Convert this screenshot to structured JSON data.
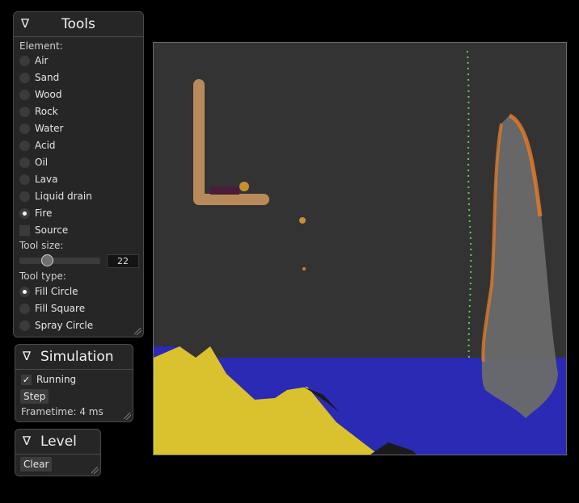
{
  "tools": {
    "title": "Tools",
    "element_label": "Element:",
    "elements": [
      {
        "label": "Air",
        "selected": false
      },
      {
        "label": "Sand",
        "selected": false
      },
      {
        "label": "Wood",
        "selected": false
      },
      {
        "label": "Rock",
        "selected": false
      },
      {
        "label": "Water",
        "selected": false
      },
      {
        "label": "Acid",
        "selected": false
      },
      {
        "label": "Oil",
        "selected": false
      },
      {
        "label": "Lava",
        "selected": false
      },
      {
        "label": "Liquid drain",
        "selected": false
      },
      {
        "label": "Fire",
        "selected": true
      }
    ],
    "source_label": "Source",
    "source_checked": false,
    "tool_size_label": "Tool size:",
    "tool_size_value": "22",
    "tool_type_label": "Tool type:",
    "tool_types": [
      {
        "label": "Fill Circle",
        "selected": true
      },
      {
        "label": "Fill Square",
        "selected": false
      },
      {
        "label": "Spray Circle",
        "selected": false
      }
    ]
  },
  "simulation": {
    "title": "Simulation",
    "running_label": "Running",
    "running_checked": true,
    "step_label": "Step",
    "frametime": "Frametime: 4 ms"
  },
  "level": {
    "title": "Level",
    "clear_label": "Clear"
  },
  "colors": {
    "panel_bg": "#262626",
    "canvas_bg": "#333333",
    "water": "#2a2ab4",
    "sand": "#d9c22e",
    "wood": "#b88a5a",
    "fire": "#e07a2a",
    "smoke": "#6a6a6a",
    "acid": "#5ad25a",
    "rock": "#1a1a1a"
  },
  "icons": {
    "collapse": "triangle-down-icon"
  }
}
